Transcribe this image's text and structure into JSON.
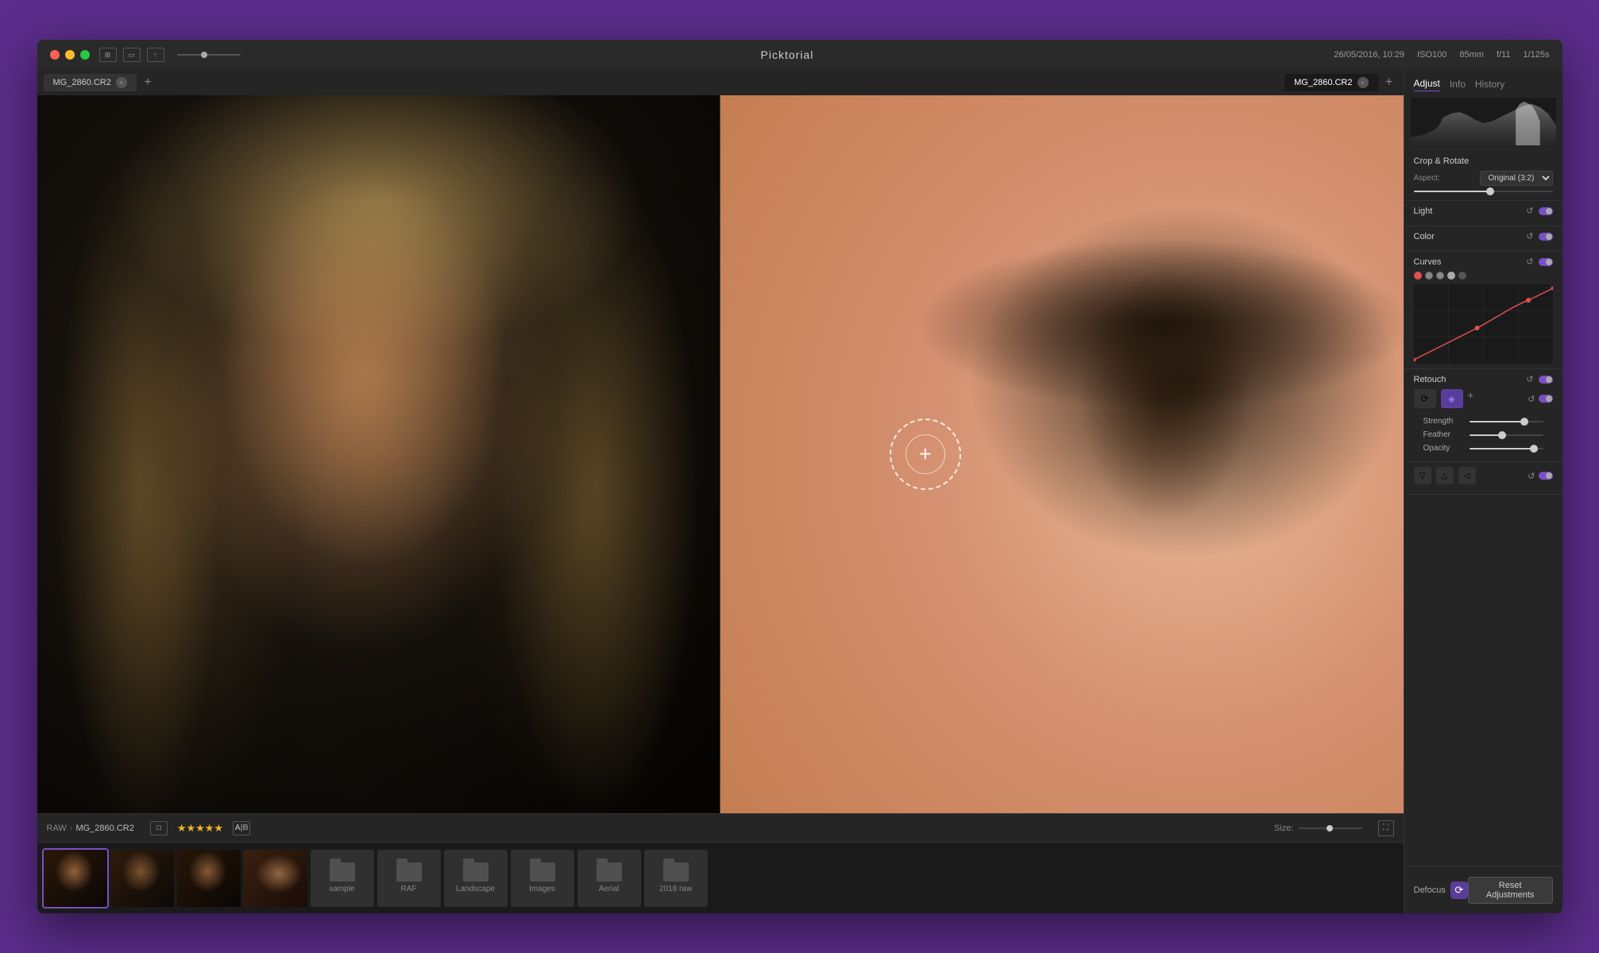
{
  "app": {
    "title": "Picktorial",
    "datetime": "26/05/2016, 10:29",
    "meta": {
      "iso": "ISO100",
      "focal": "85mm",
      "aperture": "f/11",
      "shutter": "1/125s"
    }
  },
  "tabs": [
    {
      "id": "left",
      "label": "MG_2860.CR2",
      "active": false
    },
    {
      "id": "right",
      "label": "MG_2860.CR2",
      "active": true
    }
  ],
  "toolbar": {
    "slider_label": "slider",
    "add_tab": "+"
  },
  "panel": {
    "tabs": [
      {
        "id": "adjust",
        "label": "Adjust",
        "active": true
      },
      {
        "id": "info",
        "label": "Info",
        "active": false
      },
      {
        "id": "history",
        "label": "History",
        "active": false
      }
    ],
    "sections": {
      "crop": {
        "title": "Crop & Rotate",
        "aspect_label": "Aspect:",
        "aspect_value": "Original (3:2)"
      },
      "light": {
        "title": "Light"
      },
      "color": {
        "title": "Color"
      },
      "curves": {
        "title": "Curves"
      },
      "retouch": {
        "title": "Retouch"
      },
      "defocus": {
        "label": "Defocus"
      }
    }
  },
  "statusbar": {
    "breadcrumb_raw": "RAW",
    "breadcrumb_sep": "›",
    "breadcrumb_file": "MG_2860.CR2",
    "rating": "★★★★★",
    "size_label": "Size:",
    "ab_label": "A|B"
  },
  "filmstrip": {
    "thumbs": [
      {
        "id": 1,
        "active": true
      },
      {
        "id": 2,
        "active": false
      },
      {
        "id": 3,
        "active": false
      },
      {
        "id": 4,
        "active": false
      }
    ],
    "folders": [
      {
        "id": "sample",
        "label": "sample"
      },
      {
        "id": "raf",
        "label": "RAF"
      },
      {
        "id": "landscape",
        "label": "Landscape"
      },
      {
        "id": "images",
        "label": "Images"
      },
      {
        "id": "aerial",
        "label": "Aerial"
      },
      {
        "id": "2018raw",
        "label": "2018 raw"
      }
    ]
  },
  "bottom": {
    "defocus_label": "Defocus",
    "reset_label": "Reset Adjustments"
  }
}
